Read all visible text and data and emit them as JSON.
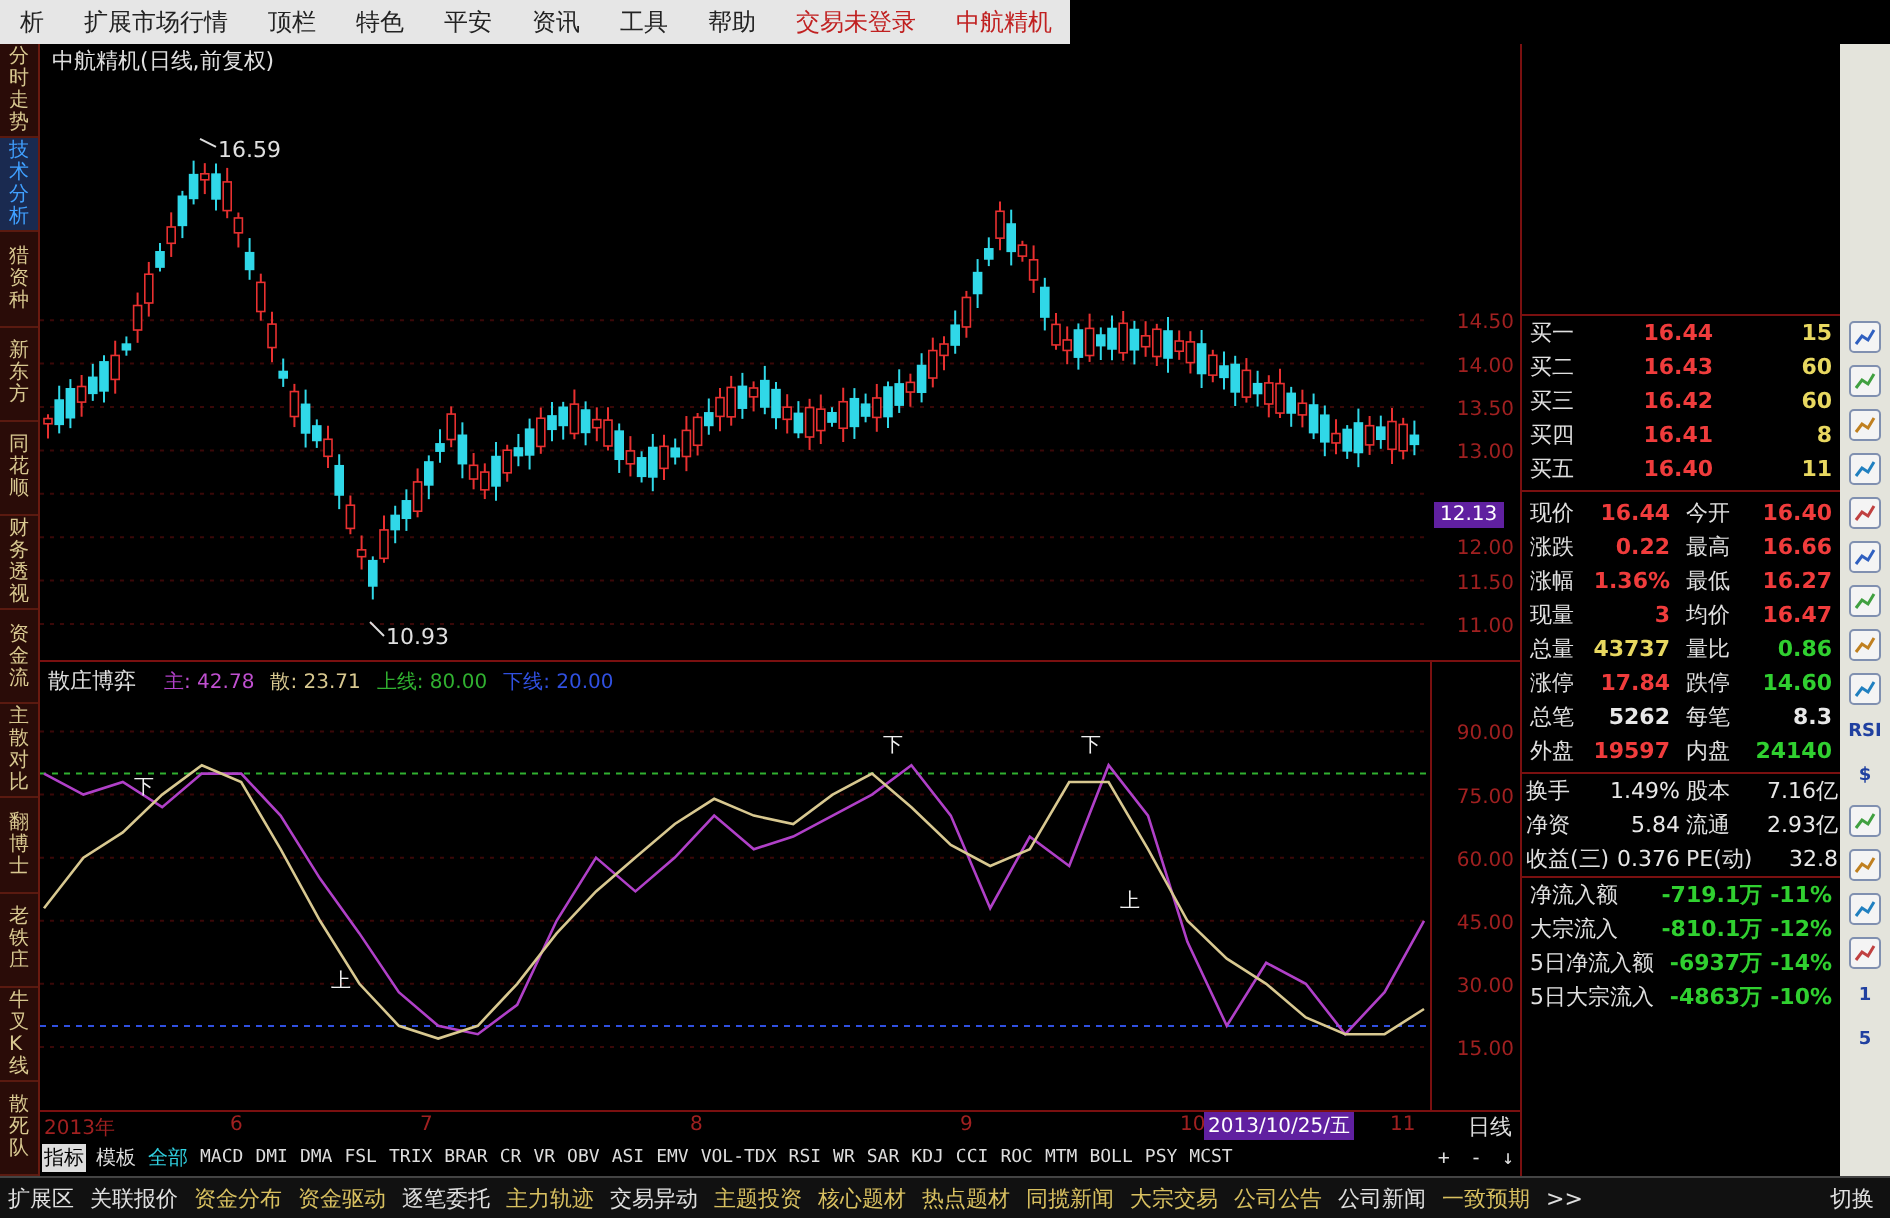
{
  "menu": {
    "items": [
      "析",
      "扩展市场行情",
      "顶栏",
      "特色",
      "平安",
      "资讯",
      "工具",
      "帮助"
    ],
    "status": [
      "交易未登录",
      "中航精机"
    ]
  },
  "side_tabs": [
    {
      "label": "分时走势",
      "selected": false
    },
    {
      "label": "技术分析",
      "selected": true
    },
    {
      "label": "猎资种",
      "selected": false
    },
    {
      "label": "新东方",
      "selected": false
    },
    {
      "label": "同花顺",
      "selected": false
    },
    {
      "label": "财务透视",
      "selected": false
    },
    {
      "label": "资金流",
      "selected": false
    },
    {
      "label": "主散对比",
      "selected": false
    },
    {
      "label": "翻博士",
      "selected": false
    },
    {
      "label": "老铁庄",
      "selected": false
    },
    {
      "label": "牛叉K线",
      "selected": false
    },
    {
      "label": "散死队",
      "selected": false
    }
  ],
  "main_chart": {
    "title": "中航精机(日线,前复权)",
    "high_label": "16.59",
    "low_label": "10.93",
    "price_axis": [
      "14.50",
      "14.00",
      "13.50",
      "13.00",
      "12.00",
      "11.50",
      "11.00"
    ],
    "cursor_price": "12.13"
  },
  "indicator": {
    "title": "散庄博弈",
    "readings": [
      {
        "text": ": 42.78",
        "color": "#c050d0"
      },
      {
        "text": ": 23.71",
        "color": "#d8c890"
      }
    ],
    "chart_data": {
      "type": "line",
      "grid": true,
      "ylim": [
        0,
        107
      ],
      "yticks": [
        {
          "value": 15,
          "label": "15.00"
        },
        {
          "value": 30,
          "label": "30.00"
        },
        {
          "value": 45,
          "label": "45.00"
        },
        {
          "value": 60,
          "label": "60.00"
        },
        {
          "value": 75,
          "label": "75.00"
        },
        {
          "value": 90,
          "label": "90.00"
        }
      ],
      "ref_lines": [
        {
          "axis": "y",
          "value": 80,
          "label": "上线: 80.00",
          "color": "#30b030"
        },
        {
          "axis": "y",
          "value": 20,
          "label": "下线: 20.00",
          "color": "#3050e0"
        }
      ],
      "series": [
        {
          "name": "主",
          "color": "#b040c8",
          "values": [
            80,
            75,
            78,
            72,
            80,
            80,
            70,
            55,
            42,
            28,
            20,
            18,
            25,
            45,
            60,
            52,
            60,
            70,
            62,
            65,
            70,
            75,
            82,
            70,
            48,
            65,
            58,
            82,
            70,
            40,
            20,
            35,
            30,
            18,
            28,
            45
          ]
        },
        {
          "name": "散",
          "color": "#d8c890",
          "values": [
            48,
            60,
            66,
            75,
            82,
            78,
            62,
            45,
            30,
            20,
            17,
            20,
            30,
            42,
            52,
            60,
            68,
            74,
            70,
            68,
            75,
            80,
            72,
            63,
            58,
            62,
            78,
            78,
            62,
            45,
            36,
            30,
            22,
            18,
            18,
            24
          ]
        }
      ],
      "annotations": [
        "下",
        "上",
        "下",
        "下",
        "上"
      ]
    }
  },
  "date_axis": {
    "labels": [
      "2013年",
      "6",
      "7",
      "8",
      "9",
      "10",
      "11"
    ],
    "cursor_date": "2013/10/25/五",
    "period": "日线"
  },
  "indicator_tabs": [
    {
      "label": "指标",
      "kind": "mode",
      "selected": true
    },
    {
      "label": "模板",
      "kind": "mode",
      "selected": false
    },
    {
      "label": "全部",
      "kind": "group",
      "selected": false
    },
    {
      "label": "MACD",
      "kind": "indicator",
      "selected": false
    },
    {
      "label": "DMI",
      "kind": "indicator",
      "selected": false
    },
    {
      "label": "DMA",
      "kind": "indicator",
      "selected": false
    },
    {
      "label": "FSL",
      "kind": "indicator",
      "selected": false
    },
    {
      "label": "TRIX",
      "kind": "indicator",
      "selected": false
    },
    {
      "label": "BRAR",
      "kind": "indicator",
      "selected": false
    },
    {
      "label": "CR",
      "kind": "indicator",
      "selected": false
    },
    {
      "label": "VR",
      "kind": "indicator",
      "selected": false
    },
    {
      "label": "OBV",
      "kind": "indicator",
      "selected": false
    },
    {
      "label": "ASI",
      "kind": "indicator",
      "selected": false
    },
    {
      "label": "EMV",
      "kind": "indicator",
      "selected": false
    },
    {
      "label": "VOL-TDX",
      "kind": "indicator",
      "selected": false
    },
    {
      "label": "RSI",
      "kind": "indicator",
      "selected": false
    },
    {
      "label": "WR",
      "kind": "indicator",
      "selected": false
    },
    {
      "label": "SAR",
      "kind": "indicator",
      "selected": false
    },
    {
      "label": "KDJ",
      "kind": "indicator",
      "selected": false
    },
    {
      "label": "CCI",
      "kind": "indicator",
      "selected": false
    },
    {
      "label": "ROC",
      "kind": "indicator",
      "selected": false
    },
    {
      "label": "MTM",
      "kind": "indicator",
      "selected": false
    },
    {
      "label": "BOLL",
      "kind": "indicator",
      "selected": false
    },
    {
      "label": "PSY",
      "kind": "indicator",
      "selected": false
    },
    {
      "label": "MCST",
      "kind": "indicator",
      "selected": false
    }
  ],
  "zoom_controls": [
    "+",
    "-",
    "↓"
  ],
  "order_book": [
    {
      "label": "买一",
      "price": "16.44",
      "volume": "15"
    },
    {
      "label": "买二",
      "price": "16.43",
      "volume": "60"
    },
    {
      "label": "买三",
      "price": "16.42",
      "volume": "60"
    },
    {
      "label": "买四",
      "price": "16.41",
      "volume": "8"
    },
    {
      "label": "买五",
      "price": "16.40",
      "volume": "11"
    }
  ],
  "quote": [
    {
      "label": "现价",
      "value": "16.44",
      "color": "#f03c3c"
    },
    {
      "label": "今开",
      "value": "16.40",
      "color": "#f03c3c"
    },
    {
      "label": "涨跌",
      "value": "0.22",
      "color": "#f03c3c"
    },
    {
      "label": "最高",
      "value": "16.66",
      "color": "#f03c3c"
    },
    {
      "label": "涨幅",
      "value": "1.36%",
      "color": "#f03c3c"
    },
    {
      "label": "最低",
      "value": "16.27",
      "color": "#f03c3c"
    },
    {
      "label": "现量",
      "value": "3",
      "color": "#f03c3c"
    },
    {
      "label": "均价",
      "value": "16.47",
      "color": "#f03c3c"
    },
    {
      "label": "总量",
      "value": "43737",
      "color": "#e8d860"
    },
    {
      "label": "量比",
      "value": "0.86",
      "color": "#30d030"
    },
    {
      "label": "涨停",
      "value": "17.84",
      "color": "#f03c3c"
    },
    {
      "label": "跌停",
      "value": "14.60",
      "color": "#30d030"
    },
    {
      "label": "总笔",
      "value": "5262",
      "color": "#e8e8e8"
    },
    {
      "label": "每笔",
      "value": "8.3",
      "color": "#e8e8e8"
    },
    {
      "label": "外盘",
      "value": "19597",
      "color": "#f03c3c"
    },
    {
      "label": "内盘",
      "value": "24140",
      "color": "#30d030"
    }
  ],
  "fundamentals": [
    {
      "label": "换手",
      "value": "1.49%"
    },
    {
      "label": "股本",
      "value": "7.16亿"
    },
    {
      "label": "净资",
      "value": "5.84"
    },
    {
      "label": "流通",
      "value": "2.93亿"
    },
    {
      "label": "收益(三)",
      "value": "0.376"
    },
    {
      "label": "PE(动)",
      "value": "32.8"
    }
  ],
  "fund_flows": [
    {
      "label": "净流入额",
      "amount": "-719.1万",
      "percent": "-11%"
    },
    {
      "label": "大宗流入",
      "amount": "-810.1万",
      "percent": "-12%"
    },
    {
      "label": "5日净流入额",
      "amount": "-6937万",
      "percent": "-14%"
    },
    {
      "label": "5日大宗流入",
      "amount": "-4863万",
      "percent": "-10%"
    }
  ],
  "toolbar": [
    {
      "kind": "icon"
    },
    {
      "kind": "icon"
    },
    {
      "kind": "icon"
    },
    {
      "kind": "icon"
    },
    {
      "kind": "icon"
    },
    {
      "kind": "icon"
    },
    {
      "kind": "icon"
    },
    {
      "kind": "icon"
    },
    {
      "kind": "icon"
    },
    {
      "kind": "text",
      "label": "RSI"
    },
    {
      "kind": "text",
      "label": "$"
    },
    {
      "kind": "icon"
    },
    {
      "kind": "icon"
    },
    {
      "kind": "icon"
    },
    {
      "kind": "icon"
    },
    {
      "kind": "text",
      "label": "1"
    },
    {
      "kind": "text",
      "label": "5"
    }
  ],
  "bottom_tabs": [
    {
      "label": "扩展区",
      "color": "#e0e0e0"
    },
    {
      "label": "关联报价",
      "color": "#e0e0e0"
    },
    {
      "label": "资金分布",
      "color": "#d8c060"
    },
    {
      "label": "资金驱动",
      "color": "#d8c060"
    },
    {
      "label": "逐笔委托",
      "color": "#e0e0e0"
    },
    {
      "label": "主力轨迹",
      "color": "#d8c060"
    },
    {
      "label": "交易异动",
      "color": "#e0e0e0"
    },
    {
      "label": "主题投资",
      "color": "#d8c060"
    },
    {
      "label": "核心题材",
      "color": "#d8c060"
    },
    {
      "label": "热点题材",
      "color": "#d8c060"
    },
    {
      "label": "同揽新闻",
      "color": "#d8c060"
    },
    {
      "label": "大宗交易",
      "color": "#d8c060"
    },
    {
      "label": "公司公告",
      "color": "#d8c060"
    },
    {
      "label": "公司新闻",
      "color": "#e0e0e0"
    },
    {
      "label": "一致预期",
      "color": "#d8c060"
    },
    {
      "label": ">>",
      "color": "#e0e0e0"
    }
  ],
  "switch_label": "切换"
}
